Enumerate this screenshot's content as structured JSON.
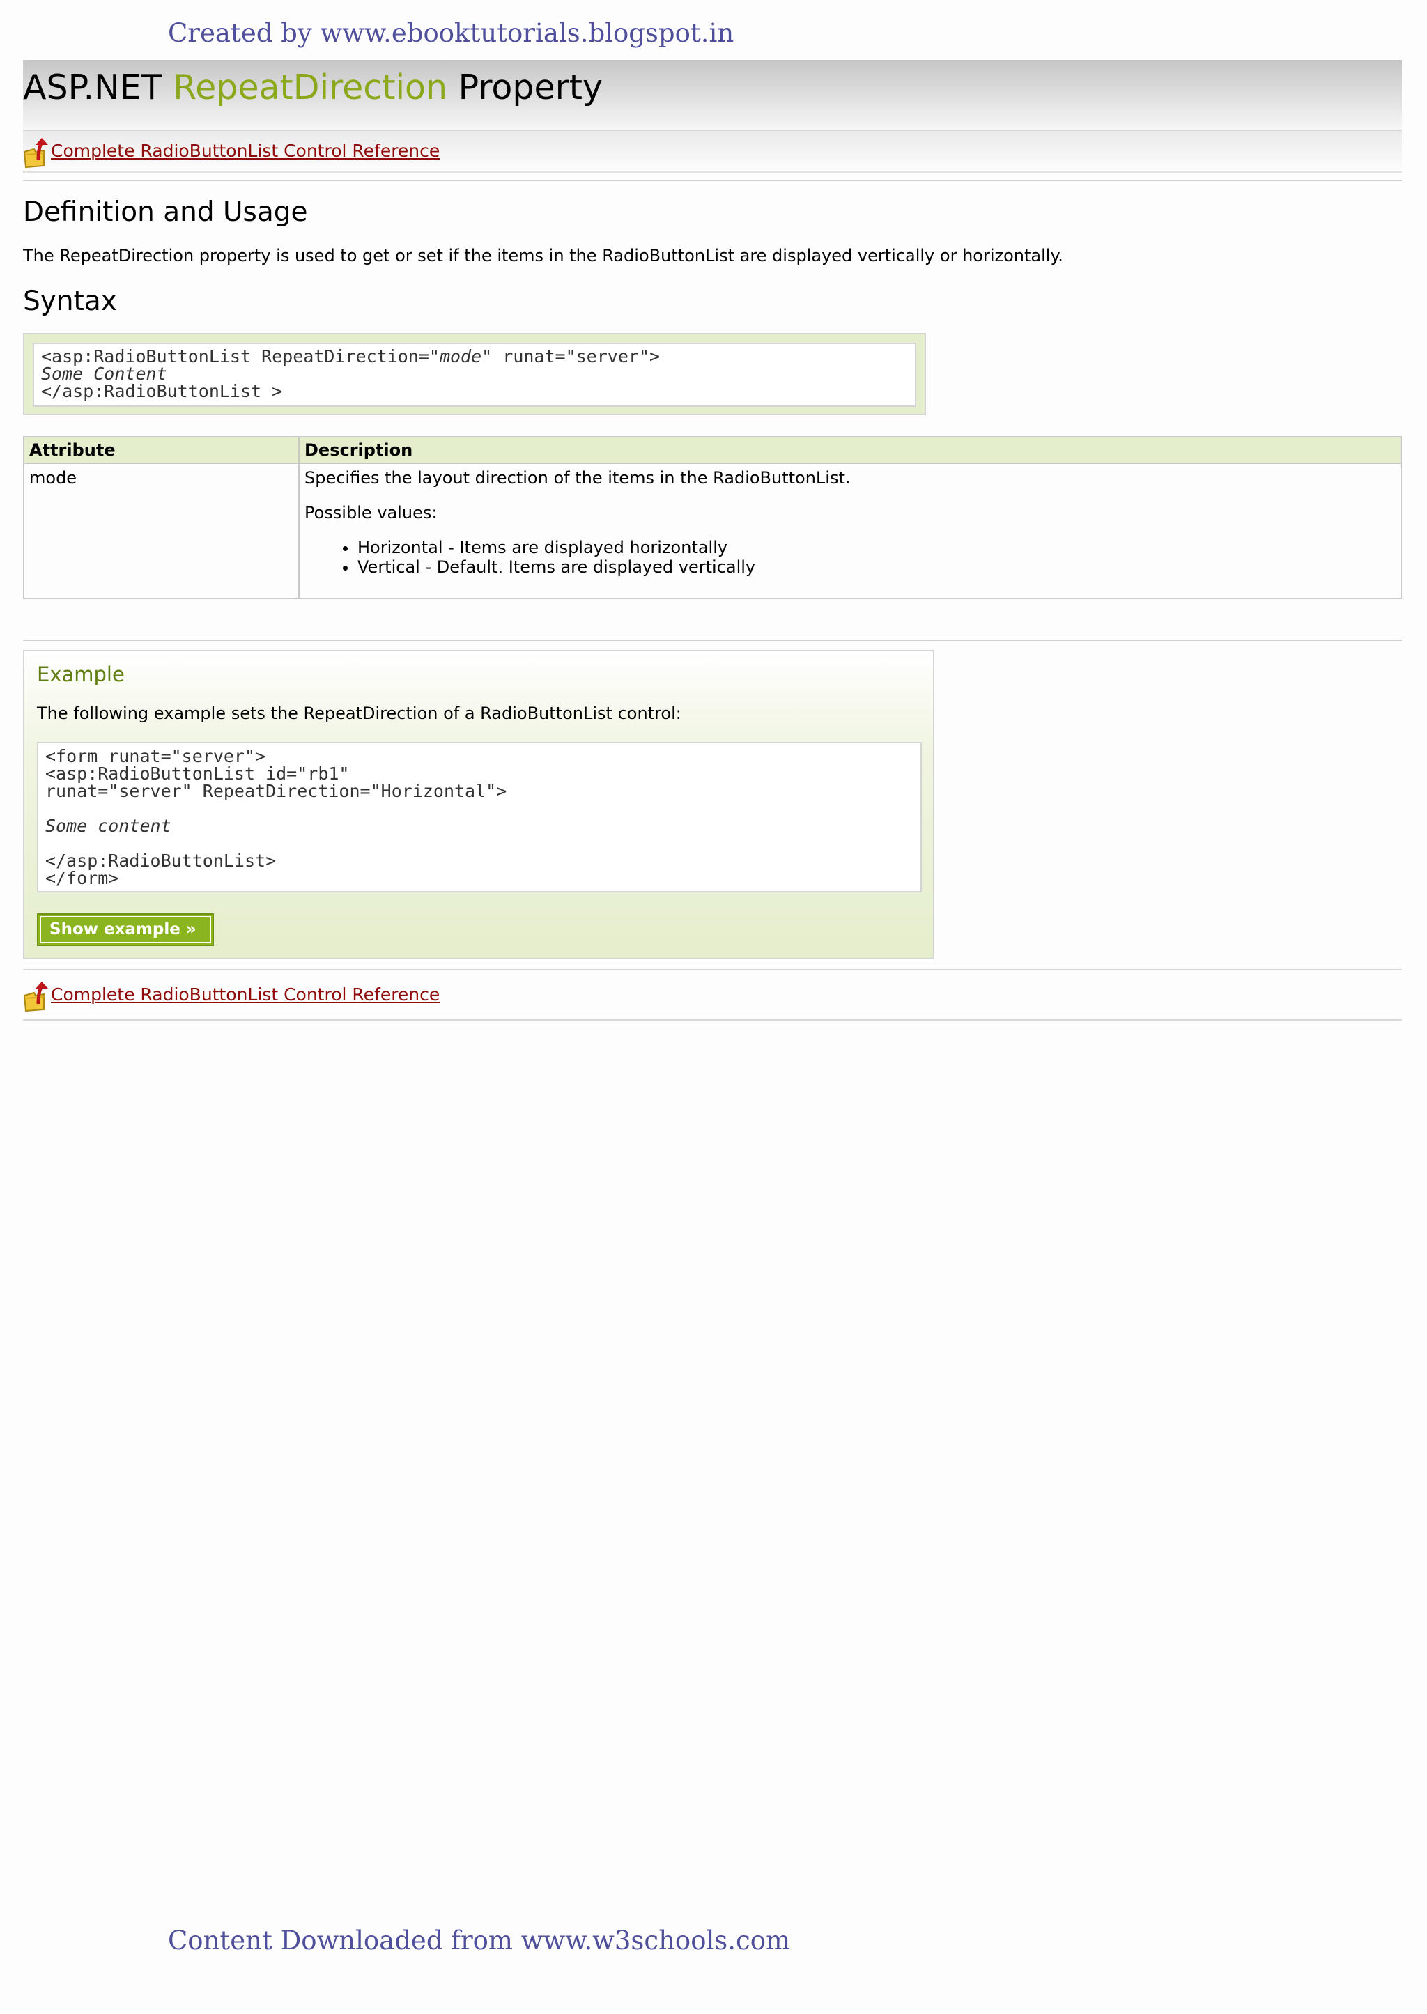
{
  "watermark_top": "Created by www.ebooktutorials.blogspot.in",
  "watermark_bottom": "Content Downloaded from www.w3schools.com",
  "title": {
    "prefix": "ASP.NET ",
    "accent": "RepeatDirection",
    "suffix": " Property",
    "accent_color": "#8aa81a"
  },
  "ref_link": " Complete RadioButtonList Control Reference",
  "definition": {
    "heading": "Definition and Usage",
    "text": "The RepeatDirection property is used to get or set if the items in the RadioButtonList are displayed vertically or horizontally."
  },
  "syntax": {
    "heading": "Syntax",
    "line1_a": "<asp:RadioButtonList RepeatDirection=\"",
    "line1_mode": "mode",
    "line1_b": "\" runat=\"server\">",
    "line2": "Some Content",
    "line3": "</asp:RadioButtonList >"
  },
  "table": {
    "headers": [
      "Attribute",
      "Description"
    ],
    "attribute": "mode",
    "description": "Specifies the layout direction of the items in the RadioButtonList.",
    "possible_label": "Possible values:",
    "values": [
      "Horizontal - Items are displayed horizontally",
      "Vertical - Default. Items are displayed vertically"
    ]
  },
  "example": {
    "title": "Example",
    "text": "The following example sets the RepeatDirection of a RadioButtonList control:",
    "code_line1": "<form runat=\"server\">",
    "code_line2": "<asp:RadioButtonList id=\"rb1\"",
    "code_line3": "runat=\"server\" RepeatDirection=\"Horizontal\">",
    "code_line4": "Some content",
    "code_line5": "</asp:RadioButtonList>",
    "code_line6": "</form>",
    "button": "Show example »"
  },
  "colors": {
    "link": "#900b09",
    "example_title": "#617f10",
    "button": "#8ab51f",
    "panel": "#e5eecc",
    "watermark": "#4f4f9c"
  }
}
